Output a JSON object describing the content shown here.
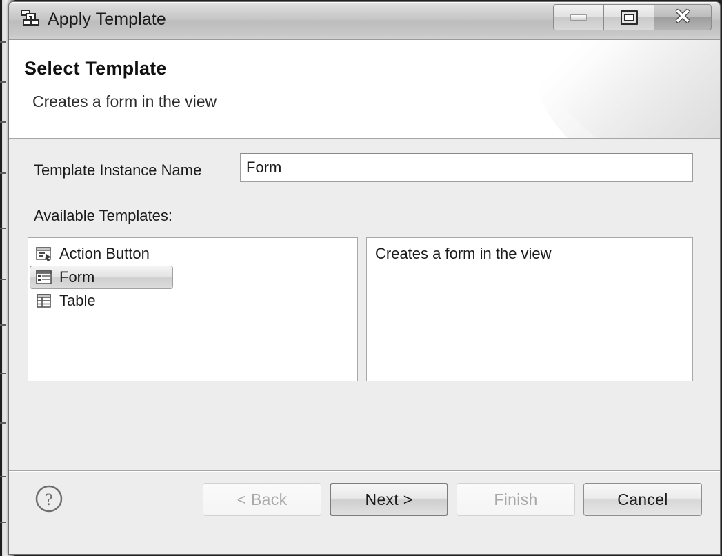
{
  "window": {
    "title": "Apply Template",
    "icon": "apply-template-icon",
    "controls": {
      "minimize": "Minimize",
      "maximize": "Maximize",
      "close": "Close"
    }
  },
  "header": {
    "title": "Select Template",
    "subtitle": "Creates a form in the view"
  },
  "form": {
    "instance_name_label": "Template Instance Name",
    "instance_name_value": "Form",
    "instance_name_placeholder": "",
    "available_label": "Available Templates:"
  },
  "templates": [
    {
      "label": "Action Button",
      "icon": "action-button-icon",
      "selected": false
    },
    {
      "label": "Form",
      "icon": "form-icon",
      "selected": true
    },
    {
      "label": "Table",
      "icon": "table-icon",
      "selected": false
    }
  ],
  "description": {
    "text": "Creates a form in the view"
  },
  "footer": {
    "help_icon": "help-question-icon",
    "buttons": [
      {
        "label": "< Back",
        "state": "disabled"
      },
      {
        "label": "Next >",
        "state": "default"
      },
      {
        "label": "Finish",
        "state": "disabled"
      },
      {
        "label": "Cancel",
        "state": "enabled"
      }
    ]
  },
  "colors": {
    "dialog_bg": "#ededed",
    "header_bg": "#ffffff",
    "field_bg": "#ffffff",
    "border": "#a8a8a8",
    "text": "#1b1b1b",
    "disabled_text": "#a9a9a9"
  }
}
